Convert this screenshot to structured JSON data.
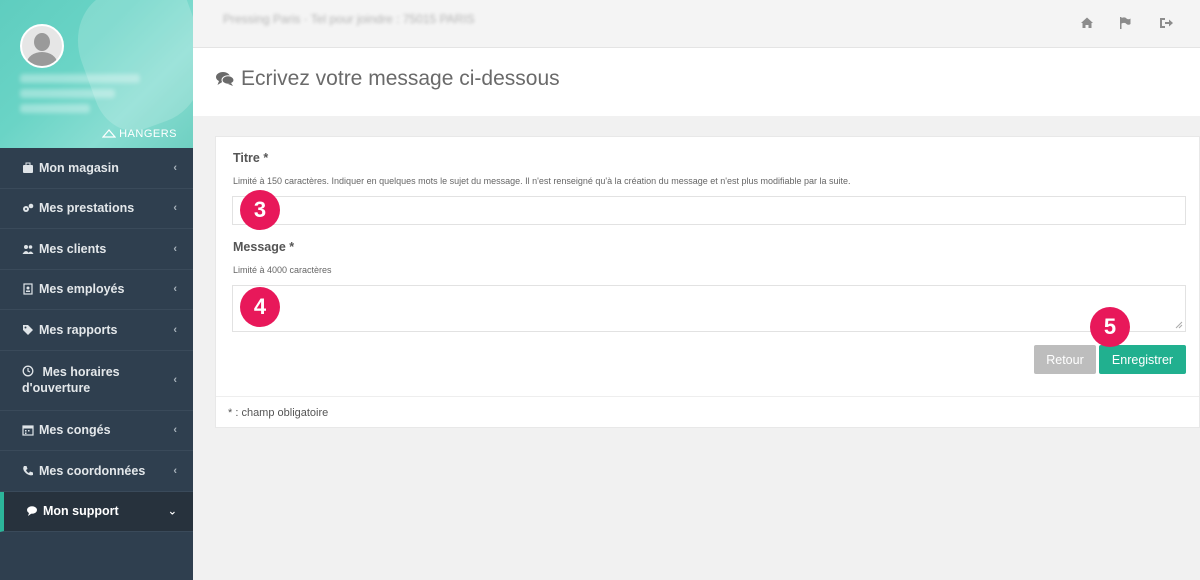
{
  "sidebar": {
    "brand": "HANGERS",
    "items": [
      {
        "label": "Mon magasin",
        "icon": "briefcase-icon"
      },
      {
        "label": "Mes prestations",
        "icon": "cogs-icon"
      },
      {
        "label": "Mes clients",
        "icon": "users-icon"
      },
      {
        "label": "Mes employés",
        "icon": "id-badge-icon"
      },
      {
        "label": "Mes rapports",
        "icon": "tags-icon"
      },
      {
        "label": "Mes horaires d'ouverture",
        "icon": "clock-icon"
      },
      {
        "label": "Mes congés",
        "icon": "calendar-icon"
      },
      {
        "label": "Mes coordonnées",
        "icon": "phone-icon"
      },
      {
        "label": "Mon support",
        "icon": "comment-icon"
      }
    ]
  },
  "topbar": {
    "info": "Pressing Paris · Tel pour joindre : 75015 PARIS",
    "icons": [
      "home-icon",
      "flag-icon",
      "logout-icon"
    ]
  },
  "page": {
    "title": "Ecrivez votre message ci-dessous"
  },
  "form": {
    "titre_label": "Titre *",
    "titre_help": "Limité à 150 caractères. Indiquer en quelques mots le sujet du message. Il n'est renseigné qu'à la création du message et n'est plus modifiable par la suite.",
    "titre_value": "",
    "message_label": "Message *",
    "message_help": "Limité à 4000 caractères",
    "message_value": "",
    "back_label": "Retour",
    "save_label": "Enregistrer",
    "required_note": "* : champ obligatoire"
  },
  "annotations": {
    "step3": "3",
    "step4": "4",
    "step5": "5"
  },
  "colors": {
    "sidebar_bg": "#2f3f4f",
    "accent": "#21b08f",
    "badge": "#e8185a",
    "back_button": "#bdbdbd"
  }
}
